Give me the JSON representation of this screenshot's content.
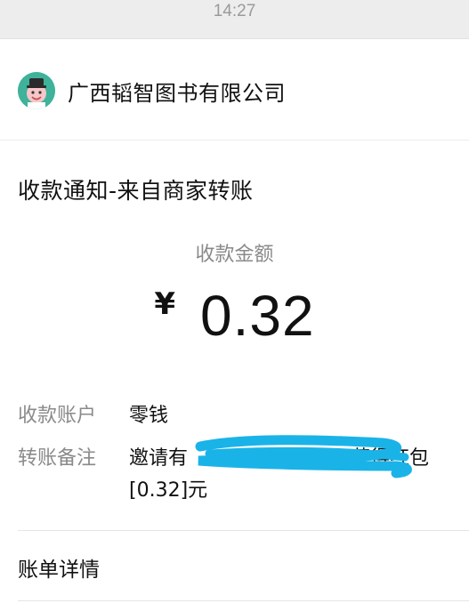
{
  "status_bar": {
    "time": "14:27"
  },
  "merchant": {
    "name": "广西韬智图书有限公司",
    "avatar_icon": "cartoon-avatar-icon"
  },
  "notice": {
    "title": "收款通知-来自商家转账",
    "amount_label": "收款金额",
    "currency": "¥",
    "amount": "0.32"
  },
  "details": {
    "account_label": "收款账户",
    "account_value": "零钱",
    "note_label": "转账备注",
    "note_line1_start": "邀请有",
    "note_line1_end": "获得红包",
    "note_line2": "[0.32]元"
  },
  "footer": {
    "bill_details": "账单详情"
  },
  "colors": {
    "redaction": "#1ab3e8",
    "avatar_bg": "#3eb29a"
  }
}
